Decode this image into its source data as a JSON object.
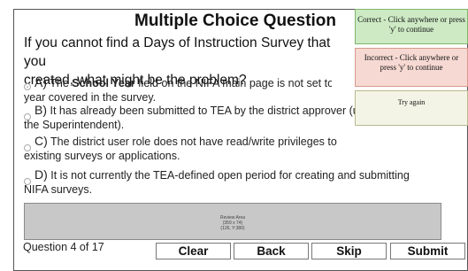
{
  "question": {
    "title": "Multiple Choice Question",
    "prompt_line1": "If you cannot find a Days of Instruction Survey that you",
    "prompt_line2": "created, what might be the problem?"
  },
  "options": [
    {
      "letter": "A)",
      "text_pre": " The ",
      "text_bold": "School Year",
      "text_post": " field on the NIFA main page is not set to the school",
      "line2": "year covered in the survey.",
      "selected": true
    },
    {
      "letter": "B)",
      "text": " It has already been submitted to TEA by the district approver (usu",
      "line2": "the Superintendent).",
      "selected": false
    },
    {
      "letter": "C)",
      "text": " The district user role does not have read/write privileges to",
      "line2": "existing surveys or applications.",
      "selected": false
    },
    {
      "letter": "D)",
      "text": " It is not currently the TEA-defined open period for creating and submitting",
      "line2": "NIFA surveys.",
      "selected": false
    }
  ],
  "review_area": {
    "label": "Review Area",
    "size": "(359 x 74)",
    "coords": "(126, Y:380)"
  },
  "footer": {
    "question_count": "Question 4 of 17"
  },
  "buttons": {
    "clear": "Clear",
    "back": "Back",
    "skip": "Skip",
    "submit": "Submit"
  },
  "feedback": {
    "correct": "Correct - Click anywhere or press 'y' to continue",
    "incorrect": "Incorrect - Click anywhere or press 'y' to continue",
    "try_again": "Try again"
  }
}
